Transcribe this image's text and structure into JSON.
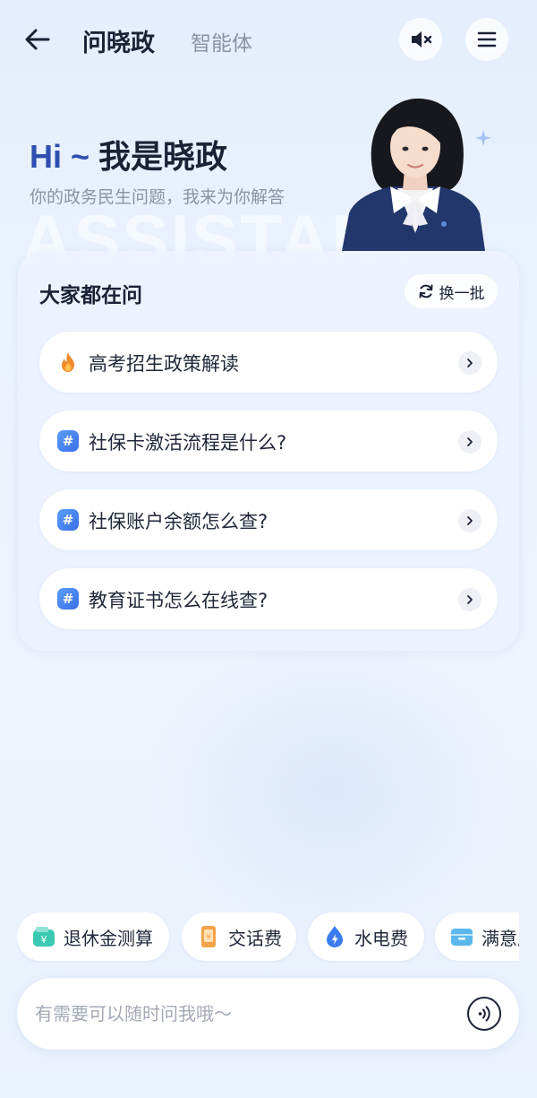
{
  "header": {
    "title": "问晓政",
    "subtitle": "智能体",
    "icons": {
      "back": "back-arrow-icon",
      "mute": "speaker-muted-icon",
      "menu": "hamburger-menu-icon"
    }
  },
  "hero": {
    "greeting_hi": "Hi ~ ",
    "greeting_name": "我是晓政",
    "description": "你的政务民生问题，我来为你解答",
    "watermark": "ASSISTANT"
  },
  "questions": {
    "title": "大家都在问",
    "refresh_label": "换一批",
    "items": [
      {
        "label": "高考招生政策解读",
        "icon": "fire-icon"
      },
      {
        "label": "社保卡激活流程是什么?",
        "icon": "hash-icon"
      },
      {
        "label": "社保账户余额怎么查?",
        "icon": "hash-icon"
      },
      {
        "label": "教育证书怎么在线查?",
        "icon": "hash-icon"
      }
    ]
  },
  "quick_actions": [
    {
      "label": "退休金测算",
      "icon": "wallet-icon",
      "color": "#3cc9b1"
    },
    {
      "label": "交话费",
      "icon": "phone-icon",
      "color": "#f3a34a"
    },
    {
      "label": "水电费",
      "icon": "water-drop-icon",
      "color": "#3b7cf0"
    },
    {
      "label": "满意度",
      "icon": "mailbox-icon",
      "color": "#5ab8ec"
    }
  ],
  "input": {
    "placeholder": "有需要可以随时问我哦～",
    "voice_icon": "voice-icon"
  },
  "colors": {
    "accent": "#2d4fb0",
    "hash_badge": "#4a85f0",
    "fire": "#f08a2a"
  }
}
